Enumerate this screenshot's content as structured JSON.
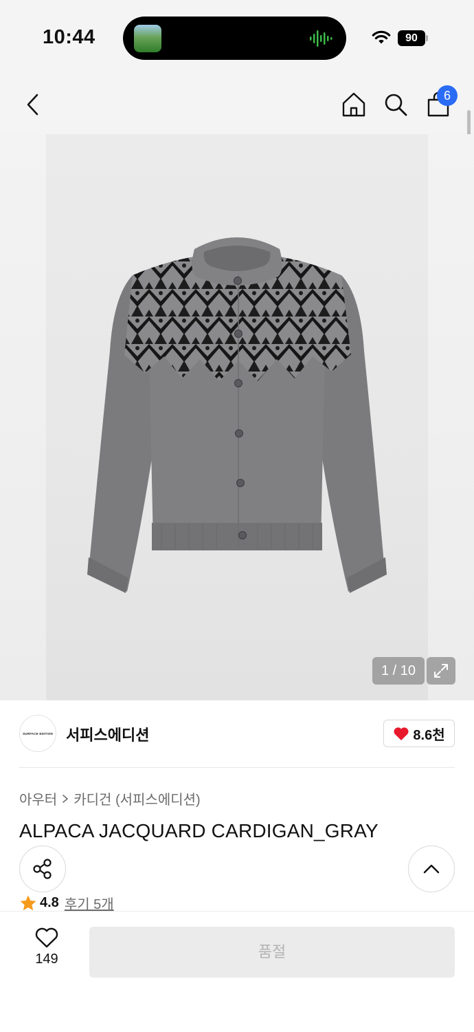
{
  "status_bar": {
    "time": "10:44",
    "battery": "90"
  },
  "header": {
    "cart_badge": "6"
  },
  "gallery": {
    "page_indicator": "1 / 10"
  },
  "brand": {
    "logo_text": "SURFACE EDITION",
    "name": "서피스에디션",
    "likes": "8.6천"
  },
  "product": {
    "breadcrumb": [
      "아우터",
      "카디건 (서피스에디션)"
    ],
    "title": "ALPACA JACQUARD CARDIGAN_GRAY",
    "rating": "4.8",
    "reviews": "후기 5개"
  },
  "bottom_bar": {
    "wish_count": "149",
    "buy_label": "품절"
  },
  "colors": {
    "badge_blue": "#2b6cf6",
    "heart_red": "#e8192c",
    "star_orange": "#f59a1b",
    "sweater_gray": "#7d7d80"
  }
}
